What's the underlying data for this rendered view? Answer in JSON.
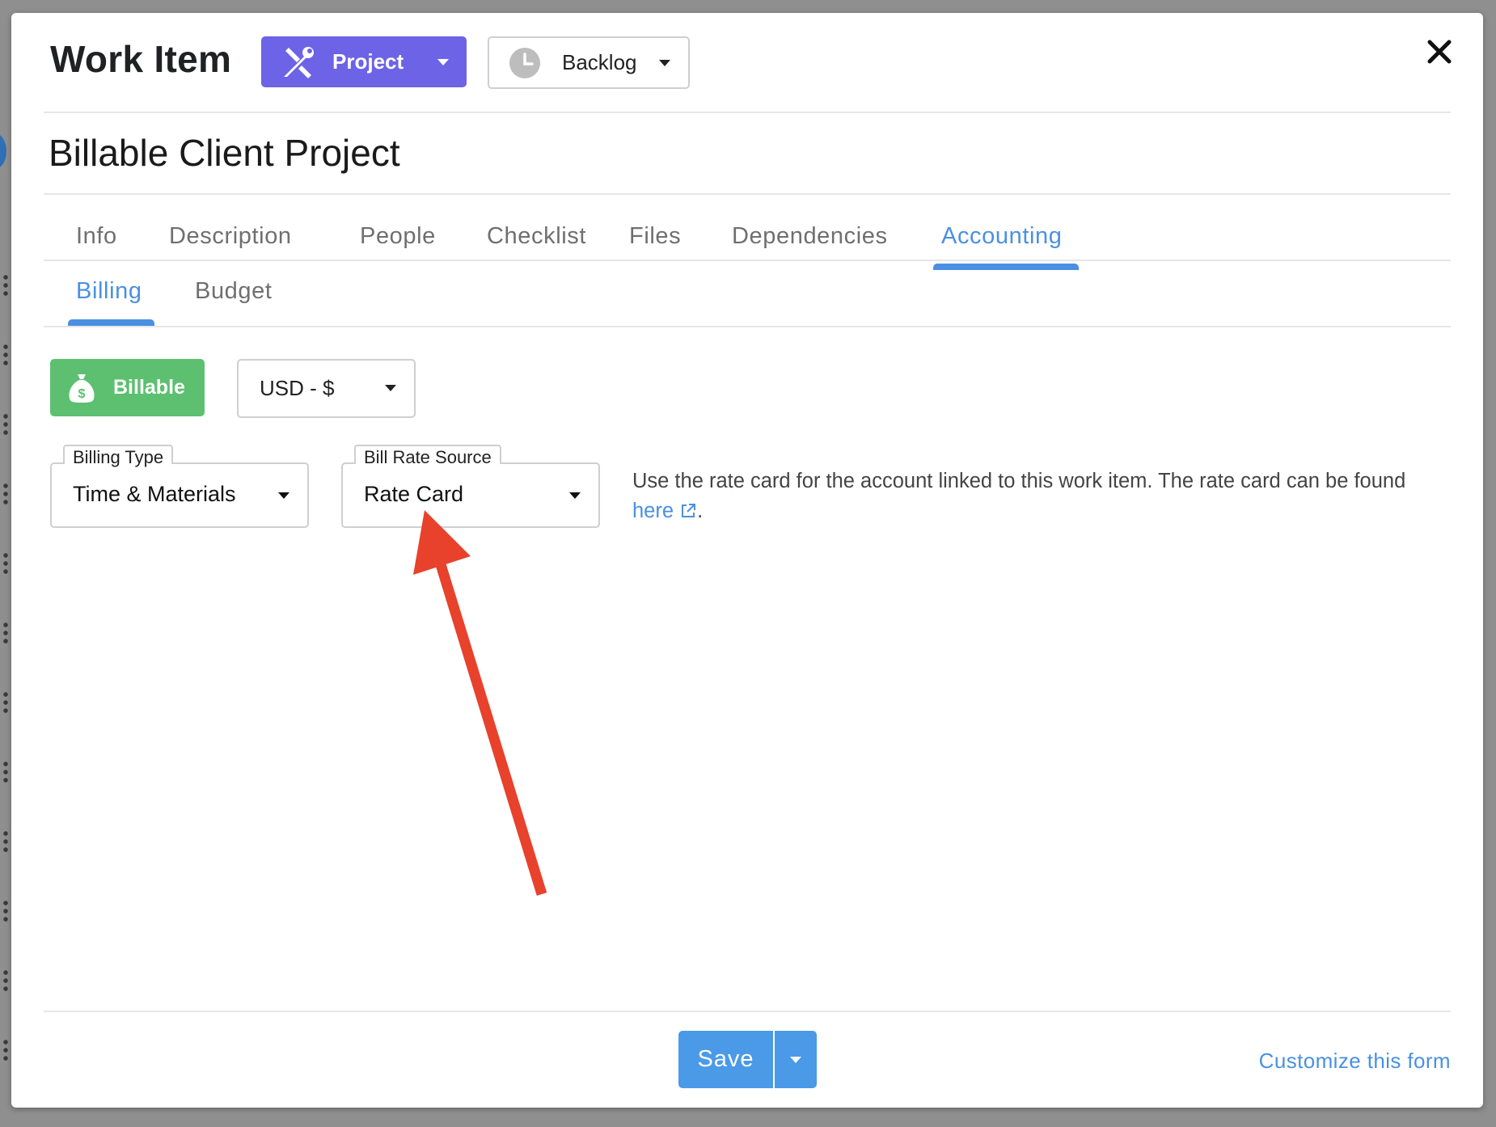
{
  "header": {
    "title": "Work Item",
    "type_button": {
      "label": "Project",
      "icon": "tools-icon"
    },
    "status_button": {
      "label": "Backlog",
      "icon": "clock-icon"
    },
    "close_icon": "close-icon"
  },
  "work_item": {
    "name": "Billable Client Project"
  },
  "tabs": [
    {
      "label": "Info",
      "active": false
    },
    {
      "label": "Description",
      "active": false
    },
    {
      "label": "People",
      "active": false
    },
    {
      "label": "Checklist",
      "active": false
    },
    {
      "label": "Files",
      "active": false
    },
    {
      "label": "Dependencies",
      "active": false
    },
    {
      "label": "Accounting",
      "active": true
    }
  ],
  "subtabs": [
    {
      "label": "Billing",
      "active": true
    },
    {
      "label": "Budget",
      "active": false
    }
  ],
  "billing": {
    "billable_toggle": {
      "label": "Billable",
      "icon": "money-bag-icon",
      "color": "#5cc070"
    },
    "currency": {
      "value": "USD - $"
    },
    "billing_type": {
      "legend": "Billing Type",
      "value": "Time & Materials"
    },
    "bill_rate_source": {
      "legend": "Bill Rate Source",
      "value": "Rate Card"
    },
    "help_text": "Use the rate card for the account linked to this work item. The rate card can be found",
    "help_link": "here",
    "help_suffix": "."
  },
  "footer": {
    "save_label": "Save",
    "customize_link": "Customize this form"
  },
  "colors": {
    "accent": "#4a90e2",
    "type_button": "#6c63e6",
    "annotation_arrow": "#e8412c"
  }
}
